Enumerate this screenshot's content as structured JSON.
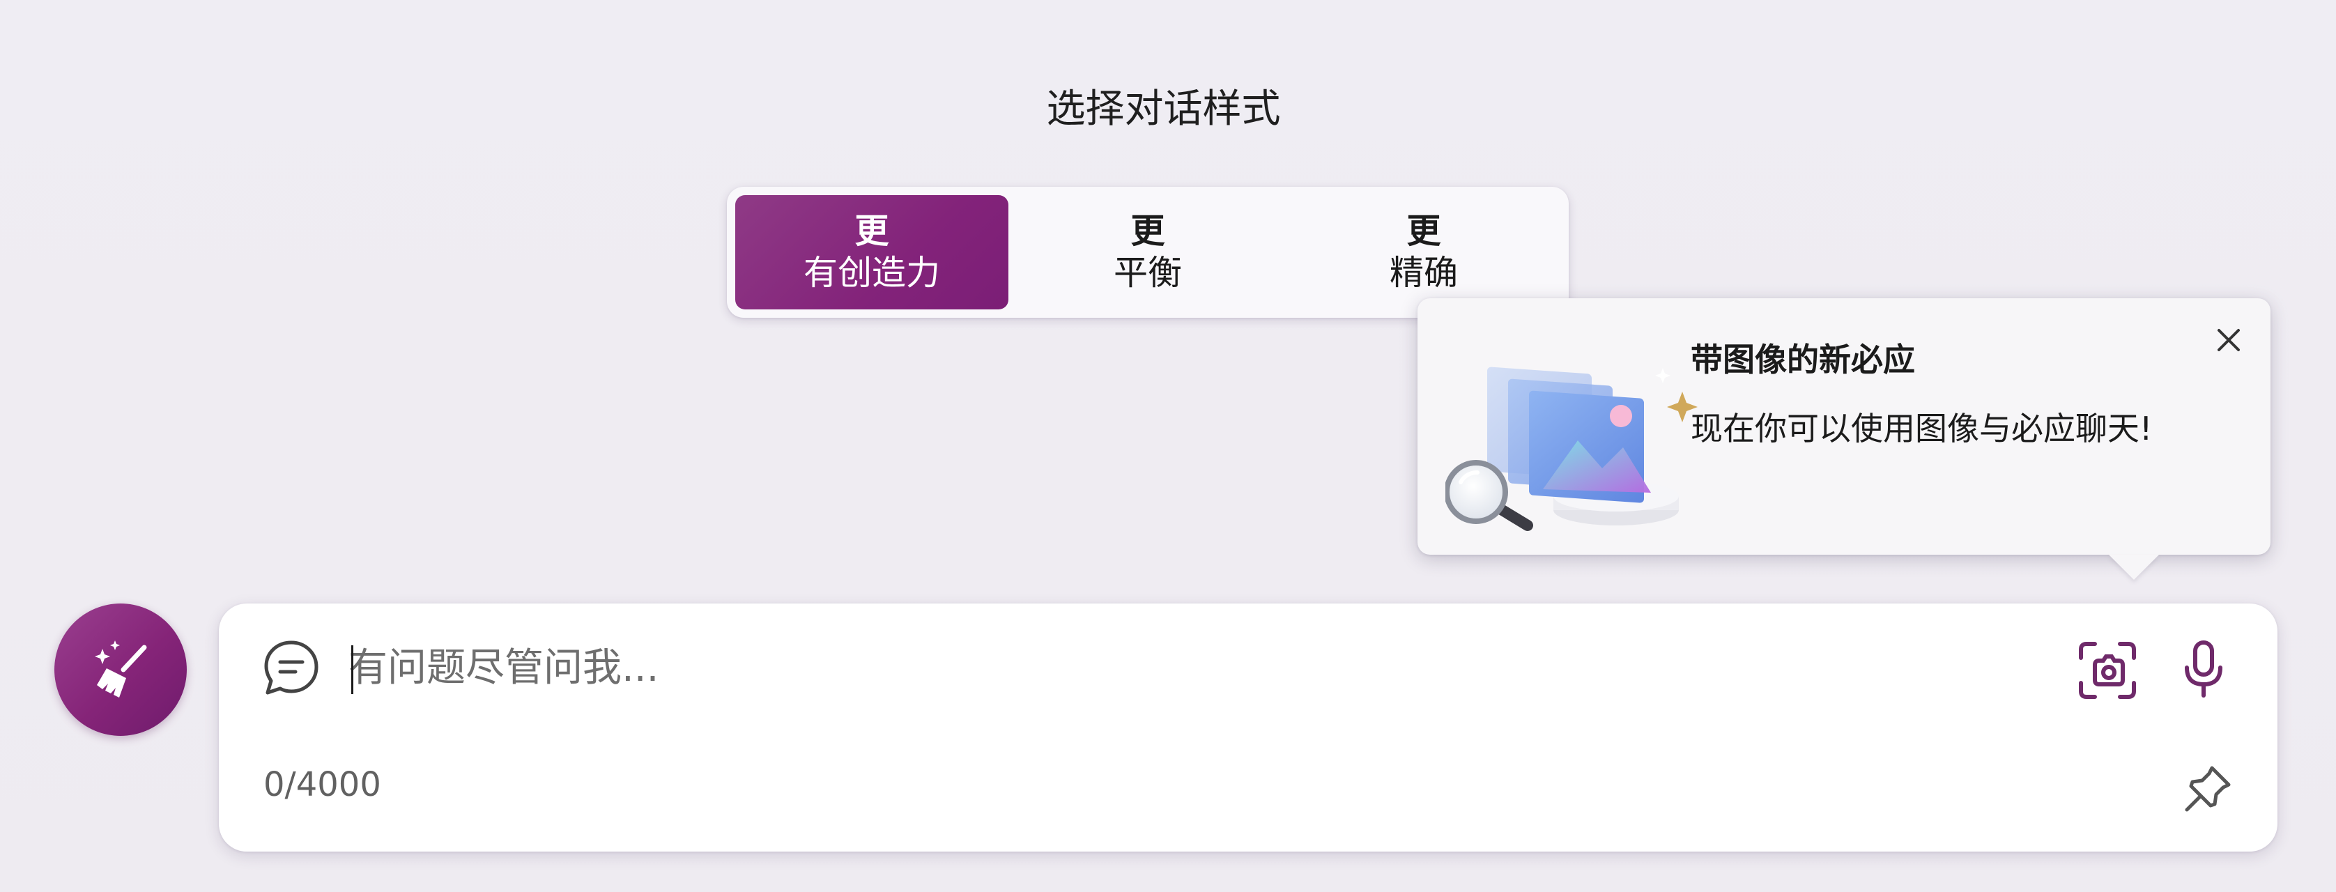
{
  "conversation_style": {
    "title": "选择对话样式",
    "options": [
      {
        "line1": "更",
        "line2": "有创造力",
        "selected": true
      },
      {
        "line1": "更",
        "line2": "平衡",
        "selected": false
      },
      {
        "line1": "更",
        "line2": "精确",
        "selected": false
      }
    ]
  },
  "popup": {
    "title": "带图像的新必应",
    "body": "现在你可以使用图像与必应聊天!",
    "close_icon": "close-icon",
    "illustration_icon": "image-magnifier-illustration"
  },
  "new_topic": {
    "icon": "broom-sparkle-icon"
  },
  "composer": {
    "placeholder": "有问题尽管问我...",
    "value": "",
    "char_count": "0/4000",
    "icons": {
      "chat": "chat-bubble-icon",
      "image_search": "camera-scan-icon",
      "mic": "microphone-icon",
      "pin": "pin-icon"
    }
  },
  "colors": {
    "accent": "#83237a",
    "icon_purple": "#6f2a6a",
    "background": "#efedf3"
  }
}
